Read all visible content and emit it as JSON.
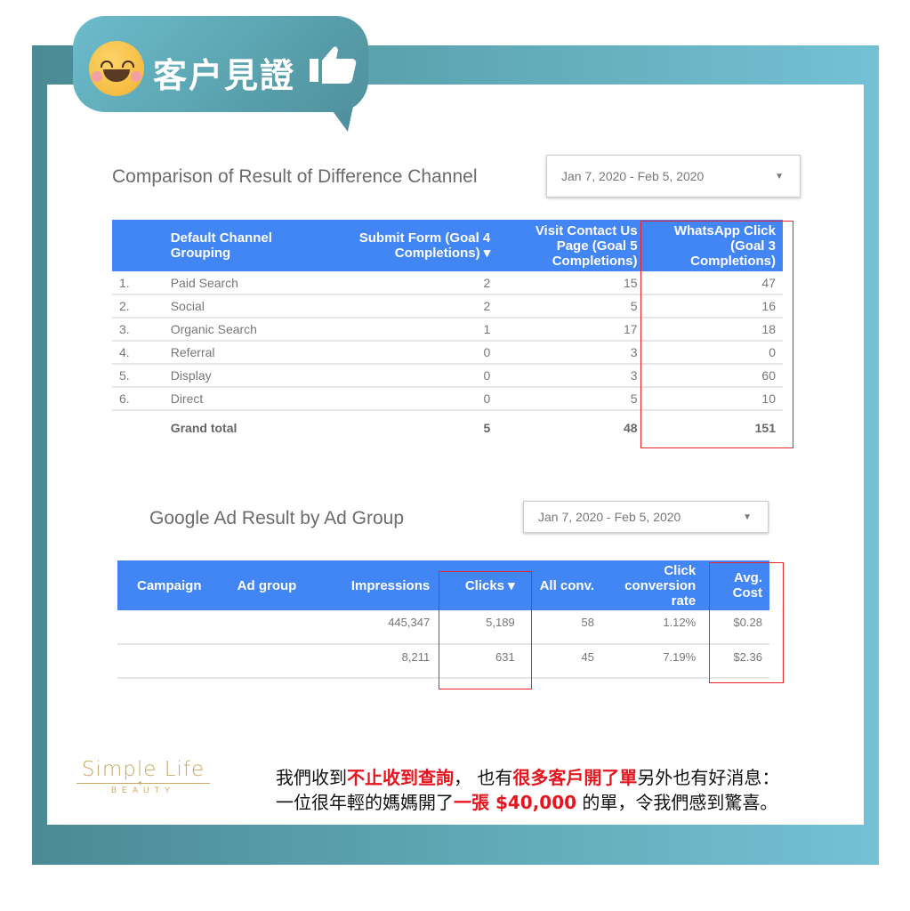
{
  "header": {
    "title": "客户見證",
    "icons": [
      "smiley-face-icon",
      "thumbs-up-icon"
    ],
    "colors": {
      "bubble": "#5aa2ae",
      "frame_start": "#4a8a94",
      "frame_end": "#74c1d5"
    }
  },
  "channel_report": {
    "title": "Comparison of Result of Difference Channel",
    "date_range": "Jan 7, 2020 - Feb 5, 2020",
    "columns": [
      "",
      "Default Channel Grouping",
      "Submit Form (Goal 4 Completions) ▾",
      "Visit Contact Us Page (Goal 5 Completions)",
      "WhatsApp Click (Goal 3 Completions)"
    ],
    "rows": [
      {
        "rank": "1.",
        "channel": "Paid Search",
        "submit_form": "2",
        "visit_contact": "15",
        "whatsapp": "47"
      },
      {
        "rank": "2.",
        "channel": "Social",
        "submit_form": "2",
        "visit_contact": "5",
        "whatsapp": "16"
      },
      {
        "rank": "3.",
        "channel": "Organic Search",
        "submit_form": "1",
        "visit_contact": "17",
        "whatsapp": "18"
      },
      {
        "rank": "4.",
        "channel": "Referral",
        "submit_form": "0",
        "visit_contact": "3",
        "whatsapp": "0"
      },
      {
        "rank": "5.",
        "channel": "Display",
        "submit_form": "0",
        "visit_contact": "3",
        "whatsapp": "60"
      },
      {
        "rank": "6.",
        "channel": "Direct",
        "submit_form": "0",
        "visit_contact": "5",
        "whatsapp": "10"
      }
    ],
    "total": {
      "label": "Grand total",
      "submit_form": "5",
      "visit_contact": "48",
      "whatsapp": "151"
    }
  },
  "ad_report": {
    "title": "Google Ad Result by Ad Group",
    "date_range": "Jan 7, 2020 - Feb 5, 2020",
    "columns": [
      "Campaign",
      "Ad group",
      "Impressions",
      "Clicks ▾",
      "All conv.",
      "Click conversion rate",
      "Avg. Cost"
    ],
    "rows": [
      {
        "campaign": "",
        "ad_group": "",
        "impressions": "445,347",
        "clicks": "5,189",
        "all_conv": "58",
        "conv_rate": "1.12%",
        "avg_cost": "$0.28"
      },
      {
        "campaign": "",
        "ad_group": "",
        "impressions": "8,211",
        "clicks": "631",
        "all_conv": "45",
        "conv_rate": "7.19%",
        "avg_cost": "$2.36"
      }
    ]
  },
  "footer": {
    "logo": {
      "brand": "Simple Life",
      "sub": "BEAUTY"
    },
    "caption": {
      "line1": [
        {
          "text": "我們收到",
          "red": false
        },
        {
          "text": "不止收到查詢",
          "red": true
        },
        {
          "text": "， 也有",
          "red": false
        },
        {
          "text": "很多客戶開了單",
          "red": true
        },
        {
          "text": "另外也有好消息：",
          "red": false
        }
      ],
      "line2": [
        {
          "text": "一位很年輕的媽媽開了",
          "red": false
        },
        {
          "text": "一張 $40,000",
          "red": true
        },
        {
          "text": " 的單，令我們感到驚喜。",
          "red": false
        }
      ],
      "highlight_color": "#e6151e"
    }
  }
}
